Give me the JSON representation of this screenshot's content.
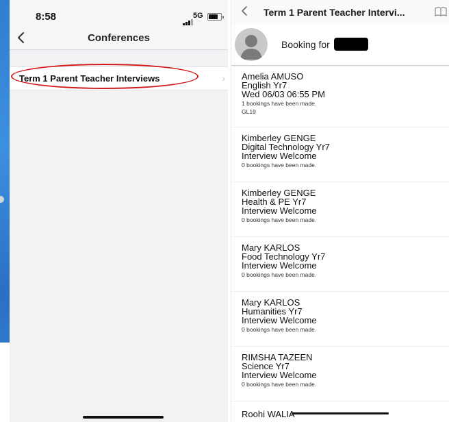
{
  "left_phone": {
    "status": {
      "time": "8:58",
      "network": "5G"
    },
    "nav": {
      "title": "Conferences",
      "back_icon": "chevron-left-icon"
    },
    "conferences": [
      {
        "label": "Term 1 Parent Teacher Interviews"
      }
    ],
    "annotation_color": "#d21a1a"
  },
  "right_phone": {
    "header": {
      "title": "Term 1 Parent Teacher Intervi...",
      "back_icon": "chevron-left-icon",
      "right_icon": "book-icon"
    },
    "booking": {
      "label": "Booking for"
    },
    "teachers": [
      {
        "teacher": "Amelia AMUSO",
        "subject": "English Yr7",
        "when": "Wed 06/03 06:55 PM",
        "count": "1 bookings have been made.",
        "room": "GL19"
      },
      {
        "teacher": "Kimberley GENGE",
        "subject": "Digital Technology Yr7",
        "when": "Interview Welcome",
        "count": "0 bookings have been made."
      },
      {
        "teacher": "Kimberley GENGE",
        "subject": "Health & PE Yr7",
        "when": "Interview Welcome",
        "count": "0 bookings have been made."
      },
      {
        "teacher": "Mary KARLOS",
        "subject": "Food Technology Yr7",
        "when": "Interview Welcome",
        "count": "0 bookings have been made."
      },
      {
        "teacher": "Mary KARLOS",
        "subject": "Humanities Yr7",
        "when": "Interview Welcome",
        "count": "0 bookings have been made."
      },
      {
        "teacher": "RIMSHA TAZEEN",
        "subject": "Science Yr7",
        "when": "Interview Welcome",
        "count": "0 bookings have been made."
      }
    ],
    "last_teacher": "Roohi WALIA"
  }
}
